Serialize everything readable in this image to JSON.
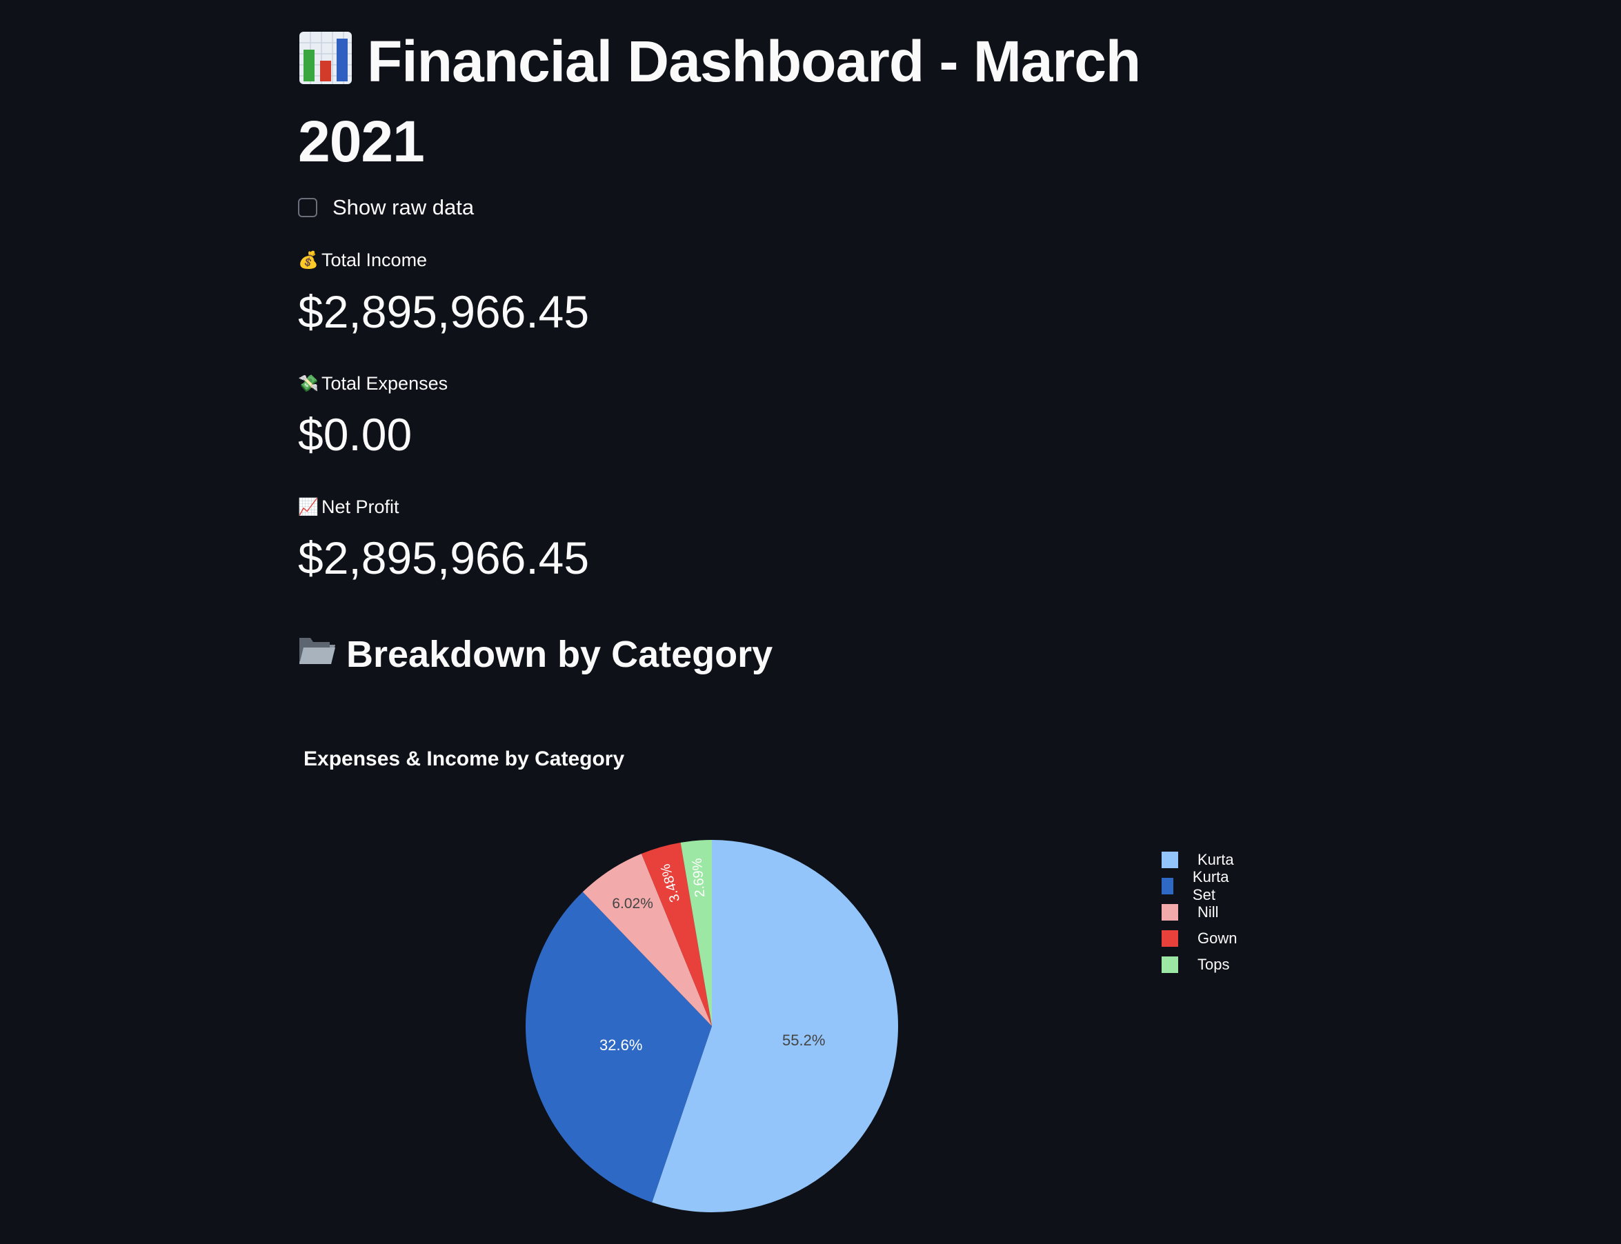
{
  "header": {
    "title": "Financial Dashboard - March 2021",
    "title_icon": "bar-chart-icon"
  },
  "controls": {
    "show_raw_data_label": "Show raw data",
    "show_raw_data_checked": false
  },
  "metrics": [
    {
      "label": "Total Income",
      "value": "$2,895,966.45",
      "icon": "money-bag-icon",
      "emoji": "💰"
    },
    {
      "label": "Total Expenses",
      "value": "$0.00",
      "icon": "money-wings-icon",
      "emoji": "💸"
    },
    {
      "label": "Net Profit",
      "value": "$2,895,966.45",
      "icon": "chart-increasing-icon",
      "emoji": "📈"
    }
  ],
  "section": {
    "heading": "Breakdown by Category",
    "icon": "folder-icon"
  },
  "colors": {
    "background": "#0e1117",
    "text": "#fafafa",
    "Kurta": "#93c5fa",
    "Kurta Set": "#2e69c6",
    "Nill": "#f3aaab",
    "Gown": "#e8403b",
    "Tops": "#9ce7a3"
  },
  "chart_data": {
    "type": "pie",
    "title": "Expenses & Income by Category",
    "categories": [
      "Kurta",
      "Kurta Set",
      "Nill",
      "Gown",
      "Tops"
    ],
    "values": [
      55.2,
      32.6,
      6.02,
      3.48,
      2.69
    ],
    "labels": [
      "55.2%",
      "32.6%",
      "6.02%",
      "3.48%",
      "2.69%"
    ],
    "legend_position": "right"
  }
}
